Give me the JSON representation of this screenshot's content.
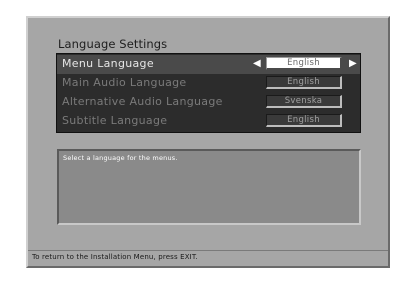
{
  "title": "Language Settings",
  "menu": {
    "rows": [
      {
        "label": "Menu Language",
        "value": "English"
      },
      {
        "label": "Main Audio Language",
        "value": "English"
      },
      {
        "label": "Alternative Audio Language",
        "value": "Svenska"
      },
      {
        "label": "Subtitle Language",
        "value": "English"
      }
    ],
    "selected_index": 0,
    "left_arrow": "◀",
    "right_arrow": "▶"
  },
  "help": {
    "text": "Select a language for the menus."
  },
  "footer": {
    "text": "To return to the Installation Menu, press EXIT."
  },
  "colors": {
    "frame": "#a6a6a6",
    "menu_bg": "#2c2c2c",
    "selected_row": "#4a4a4a"
  }
}
